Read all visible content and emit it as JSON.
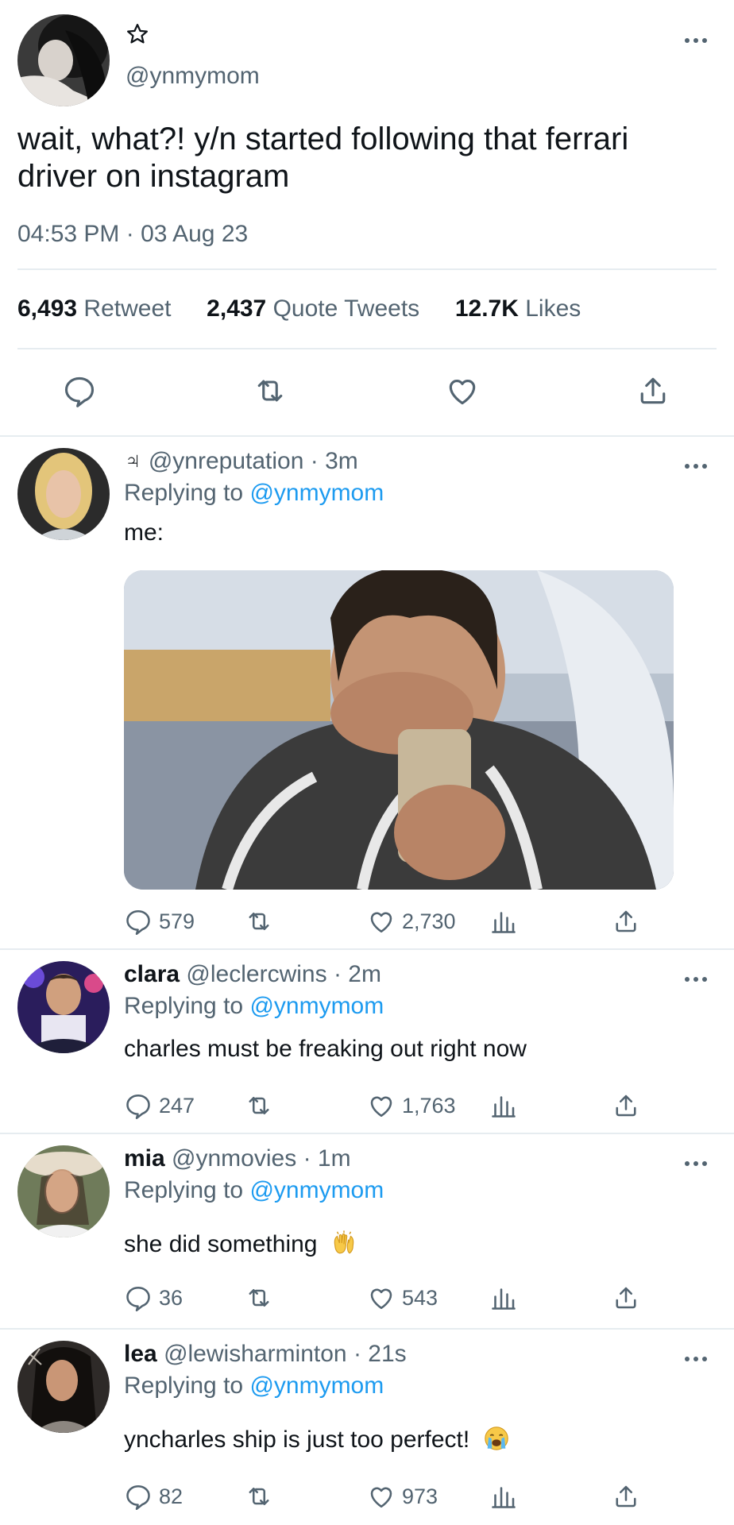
{
  "tweet": {
    "handle": "@ynmymom",
    "text": "wait, what?! y/n started following that ferrari driver on instagram",
    "timestamp": "04:53 PM · 03 Aug 23",
    "stats": {
      "retweets_count": "6,493",
      "retweets_label": "Retweet",
      "quotes_count": "2,437",
      "quotes_label": "Quote Tweets",
      "likes_count": "12.7K",
      "likes_label": "Likes"
    },
    "actions": [
      "reply-icon",
      "retweet-icon",
      "like-icon",
      "share-icon"
    ]
  },
  "replies": [
    {
      "name": "",
      "name_glyph": "♃",
      "handle": "@ynreputation",
      "time": "· 3m",
      "replying_prefix": "Replying to",
      "replying_to": "@ynmymom",
      "text": "me:",
      "reply_count": "579",
      "retweet_count": "",
      "like_count": "2,730",
      "has_media": true
    },
    {
      "name": "clara",
      "handle": "@leclercwins",
      "time": "· 2m",
      "replying_prefix": "Replying to",
      "replying_to": "@ynmymom",
      "text": "charles must be freaking out right now",
      "reply_count": "247",
      "retweet_count": "",
      "like_count": "1,763"
    },
    {
      "name": "mia",
      "handle": "@ynmovies",
      "time": "· 1m",
      "replying_prefix": "Replying to",
      "replying_to": "@ynmymom",
      "text": "she did something",
      "emoji": "raising-hands-emoji",
      "reply_count": "36",
      "retweet_count": "",
      "like_count": "543"
    },
    {
      "name": "lea",
      "handle": "@lewisharminton",
      "time": "· 21s",
      "replying_prefix": "Replying to",
      "replying_to": "@ynmymom",
      "text": "yncharles ship is just too perfect!",
      "emoji": "crying-face-emoji",
      "reply_count": "82",
      "retweet_count": "",
      "like_count": "973"
    }
  ],
  "colors": {
    "text": "#0f1419",
    "muted": "#536471",
    "link": "#1d9bf0",
    "divider": "#e6ecf0"
  }
}
